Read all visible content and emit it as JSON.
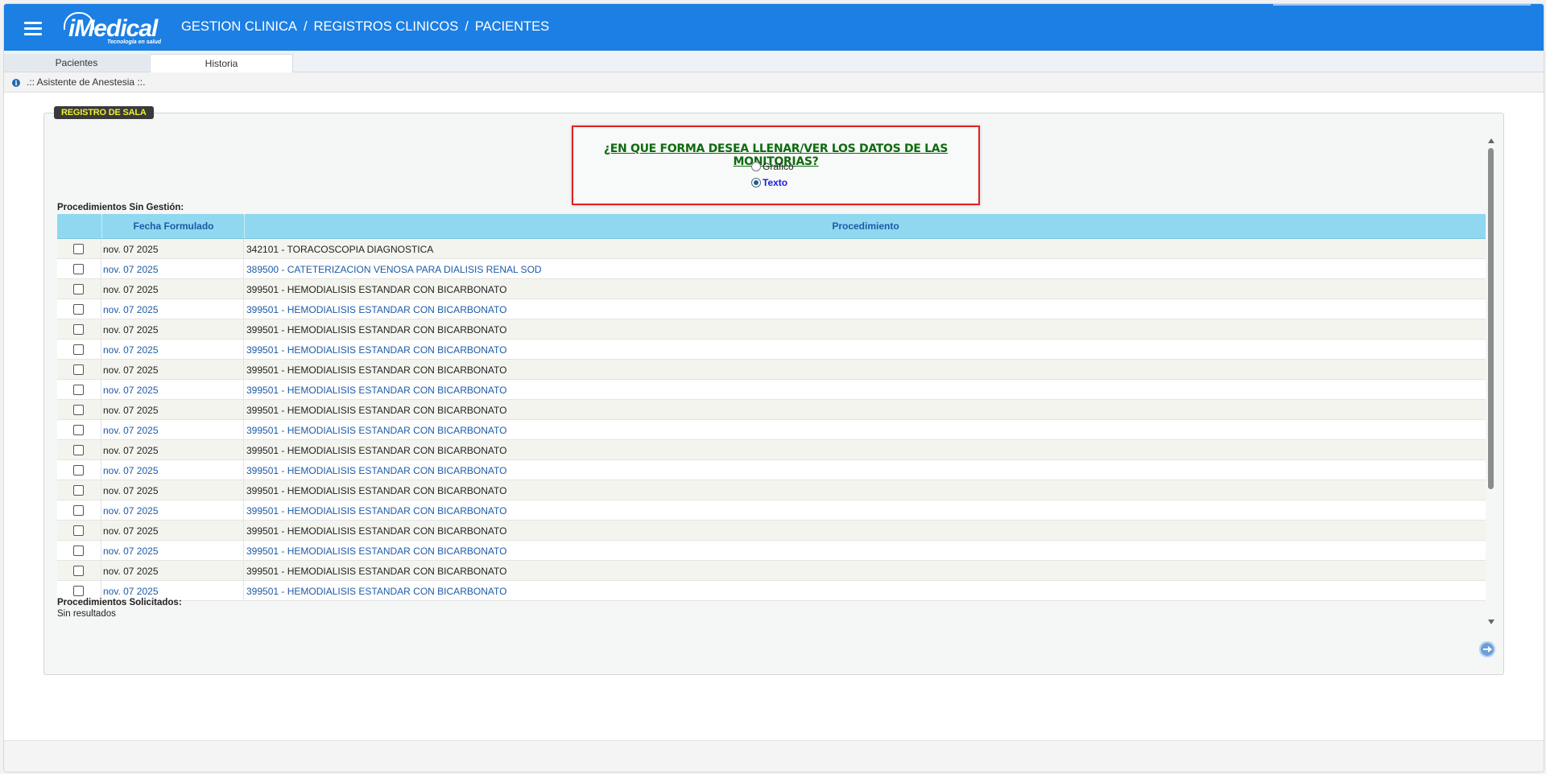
{
  "header": {
    "logo_text": "iMedical",
    "logo_tagline": "Tecnología en salud",
    "breadcrumb": [
      "GESTION CLINICA",
      "REGISTROS CLINICOS",
      "PACIENTES"
    ],
    "separator": "/"
  },
  "tabs": [
    "Pacientes",
    "Historia"
  ],
  "subbar": {
    "label": ".:: Asistente de Anestesia ::."
  },
  "section_badge": "REGISTRO DE SALA",
  "question": {
    "text": "¿EN QUE FORMA DESEA LLENAR/VER LOS DATOS DE LAS MONITORIAS?",
    "options": [
      "Gráfico",
      "Texto"
    ],
    "selected": "Texto"
  },
  "procedimientos_sin_gestion": {
    "label": "Procedimientos Sin Gestión:",
    "columns": [
      "",
      "Fecha Formulado",
      "Procedimiento"
    ],
    "rows": [
      {
        "fecha": "nov. 07 2025",
        "procedimiento": "342101 - TORACOSCOPIA DIAGNOSTICA"
      },
      {
        "fecha": "nov. 07 2025",
        "procedimiento": "389500 - CATETERIZACION VENOSA PARA DIALISIS RENAL SOD"
      },
      {
        "fecha": "nov. 07 2025",
        "procedimiento": "399501 - HEMODIALISIS ESTANDAR CON BICARBONATO"
      },
      {
        "fecha": "nov. 07 2025",
        "procedimiento": "399501 - HEMODIALISIS ESTANDAR CON BICARBONATO"
      },
      {
        "fecha": "nov. 07 2025",
        "procedimiento": "399501 - HEMODIALISIS ESTANDAR CON BICARBONATO"
      },
      {
        "fecha": "nov. 07 2025",
        "procedimiento": "399501 - HEMODIALISIS ESTANDAR CON BICARBONATO"
      },
      {
        "fecha": "nov. 07 2025",
        "procedimiento": "399501 - HEMODIALISIS ESTANDAR CON BICARBONATO"
      },
      {
        "fecha": "nov. 07 2025",
        "procedimiento": "399501 - HEMODIALISIS ESTANDAR CON BICARBONATO"
      },
      {
        "fecha": "nov. 07 2025",
        "procedimiento": "399501 - HEMODIALISIS ESTANDAR CON BICARBONATO"
      },
      {
        "fecha": "nov. 07 2025",
        "procedimiento": "399501 - HEMODIALISIS ESTANDAR CON BICARBONATO"
      },
      {
        "fecha": "nov. 07 2025",
        "procedimiento": "399501 - HEMODIALISIS ESTANDAR CON BICARBONATO"
      },
      {
        "fecha": "nov. 07 2025",
        "procedimiento": "399501 - HEMODIALISIS ESTANDAR CON BICARBONATO"
      },
      {
        "fecha": "nov. 07 2025",
        "procedimiento": "399501 - HEMODIALISIS ESTANDAR CON BICARBONATO"
      },
      {
        "fecha": "nov. 07 2025",
        "procedimiento": "399501 - HEMODIALISIS ESTANDAR CON BICARBONATO"
      },
      {
        "fecha": "nov. 07 2025",
        "procedimiento": "399501 - HEMODIALISIS ESTANDAR CON BICARBONATO"
      },
      {
        "fecha": "nov. 07 2025",
        "procedimiento": "399501 - HEMODIALISIS ESTANDAR CON BICARBONATO"
      },
      {
        "fecha": "nov. 07 2025",
        "procedimiento": "399501 - HEMODIALISIS ESTANDAR CON BICARBONATO"
      },
      {
        "fecha": "nov. 07 2025",
        "procedimiento": "399501 - HEMODIALISIS ESTANDAR CON BICARBONATO"
      }
    ]
  },
  "procedimientos_solicitados": {
    "label": "Procedimientos Solicitados:",
    "empty_text": "Sin resultados"
  },
  "icons": {
    "menu": "hamburger-menu-icon",
    "info": "info-icon",
    "next": "arrow-right-circle-icon"
  },
  "colors": {
    "topbar": "#1c7fe3",
    "grid_header": "#8fd8f0",
    "question_border": "#e02020",
    "badge_text": "#e8f232"
  }
}
